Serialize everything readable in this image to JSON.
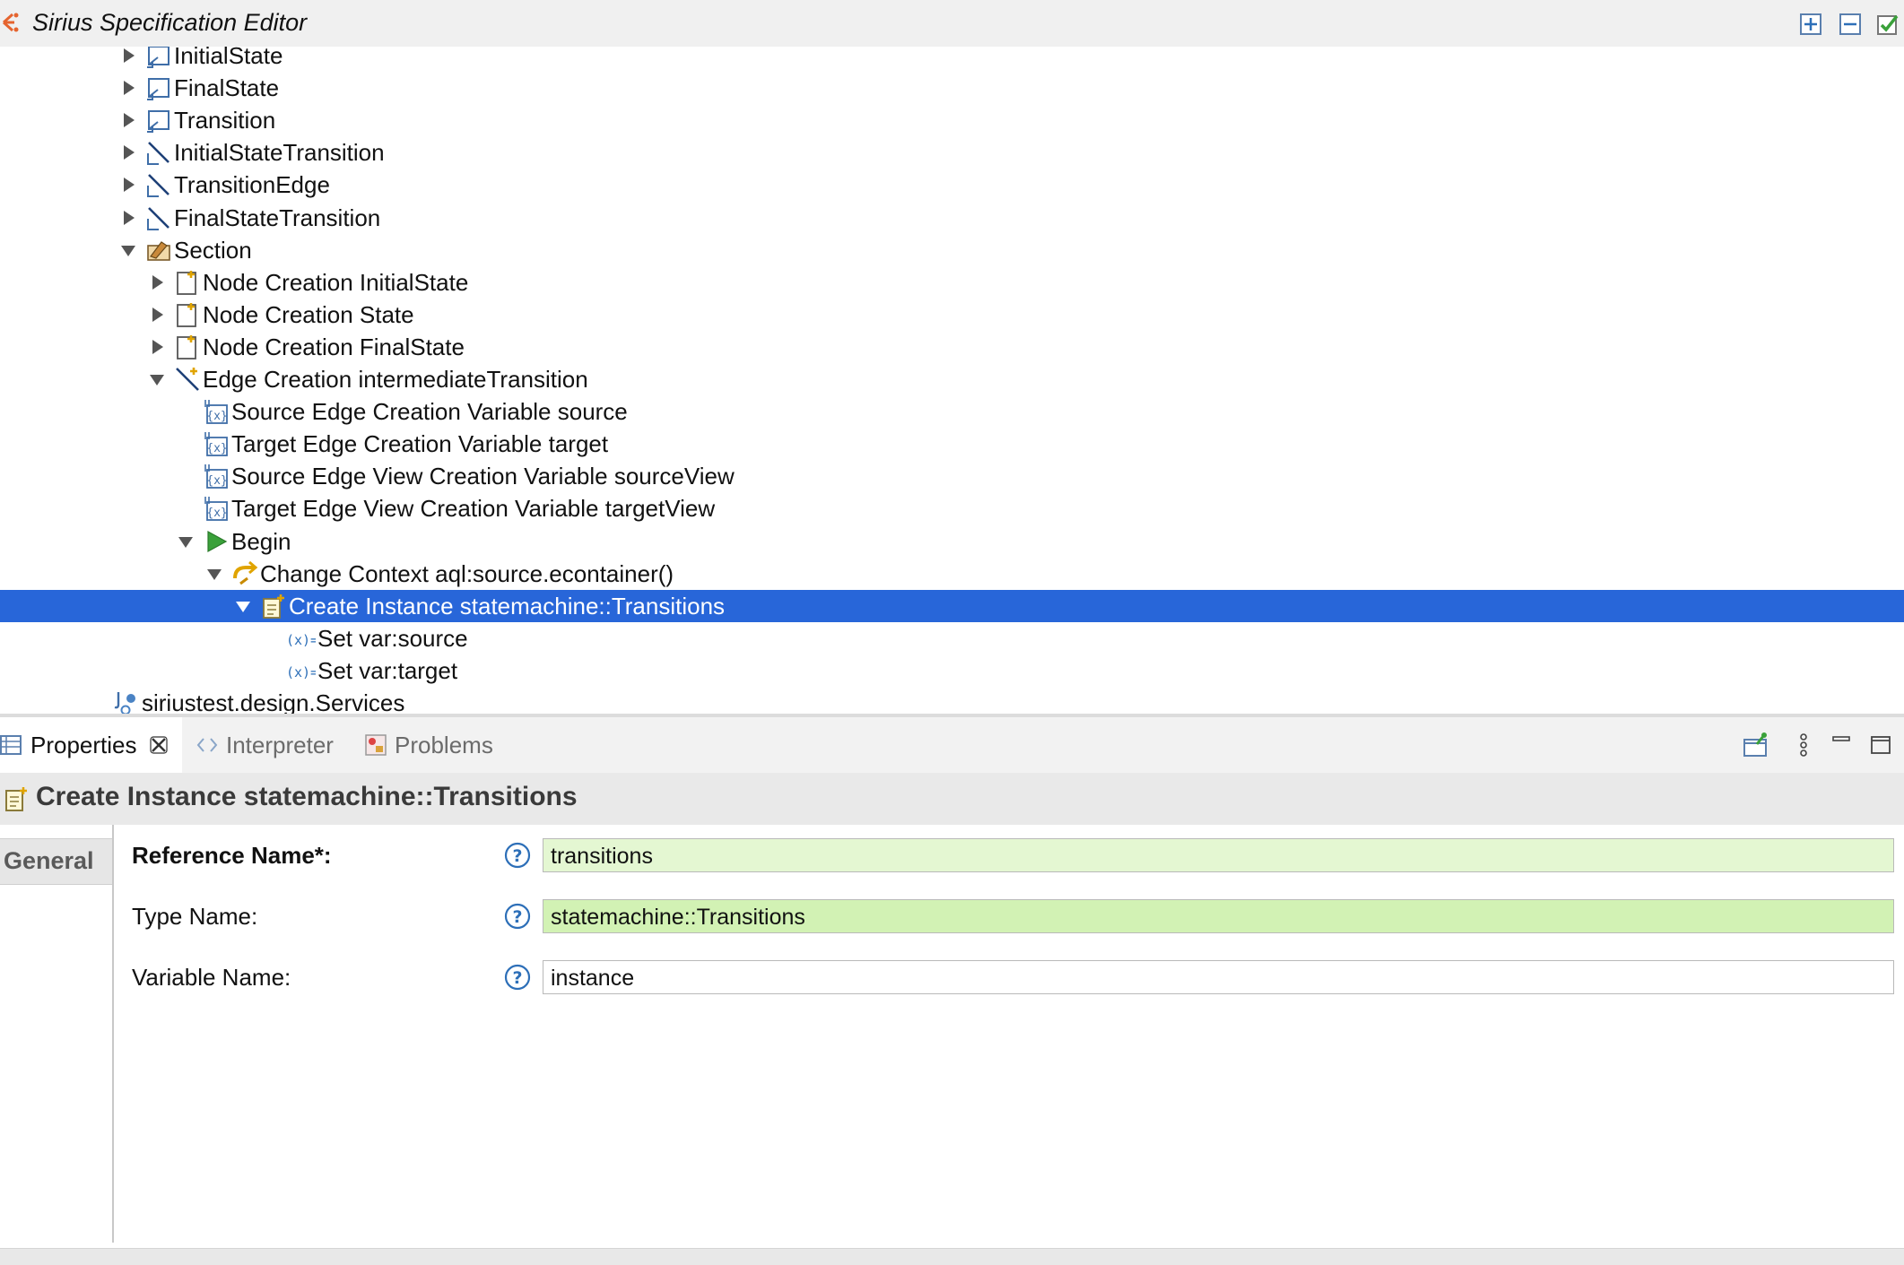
{
  "window": {
    "title": "Sirius Specification Editor",
    "icons": [
      "sirius-logo-icon",
      "expand-all-icon",
      "collapse-all-icon",
      "validate-icon"
    ]
  },
  "tree": {
    "rows": [
      {
        "label": "InitialState",
        "indent": 0,
        "twisty": "collapsed",
        "icon": "node-mapping-icon"
      },
      {
        "label": "FinalState",
        "indent": 0,
        "twisty": "collapsed",
        "icon": "node-mapping-icon"
      },
      {
        "label": "Transition",
        "indent": 0,
        "twisty": "collapsed",
        "icon": "node-mapping-icon"
      },
      {
        "label": "InitialStateTransition",
        "indent": 0,
        "twisty": "collapsed",
        "icon": "edge-mapping-icon"
      },
      {
        "label": "TransitionEdge",
        "indent": 0,
        "twisty": "collapsed",
        "icon": "edge-mapping-icon"
      },
      {
        "label": "FinalStateTransition",
        "indent": 0,
        "twisty": "collapsed",
        "icon": "edge-mapping-icon"
      },
      {
        "label": "Section",
        "indent": 0,
        "twisty": "expanded",
        "icon": "section-icon"
      },
      {
        "label": "Node Creation InitialState",
        "indent": 1,
        "twisty": "collapsed",
        "icon": "node-creation-icon"
      },
      {
        "label": "Node Creation State",
        "indent": 1,
        "twisty": "collapsed",
        "icon": "node-creation-icon"
      },
      {
        "label": "Node Creation FinalState",
        "indent": 1,
        "twisty": "collapsed",
        "icon": "node-creation-icon"
      },
      {
        "label": "Edge Creation intermediateTransition",
        "indent": 1,
        "twisty": "expanded",
        "icon": "edge-creation-icon"
      },
      {
        "label": "Source Edge Creation Variable source",
        "indent": 2,
        "twisty": "none",
        "icon": "variable-icon"
      },
      {
        "label": "Target Edge Creation Variable target",
        "indent": 2,
        "twisty": "none",
        "icon": "variable-icon"
      },
      {
        "label": "Source Edge View Creation Variable sourceView",
        "indent": 2,
        "twisty": "none",
        "icon": "variable-icon"
      },
      {
        "label": "Target Edge View Creation Variable targetView",
        "indent": 2,
        "twisty": "none",
        "icon": "variable-icon"
      },
      {
        "label": "Begin",
        "indent": 2,
        "twisty": "expanded",
        "icon": "begin-icon"
      },
      {
        "label": "Change Context aql:source.econtainer()",
        "indent": 3,
        "twisty": "expanded",
        "icon": "change-context-icon"
      },
      {
        "label": "Create Instance statemachine::Transitions",
        "indent": 4,
        "twisty": "expanded",
        "icon": "create-instance-icon",
        "selected": true
      },
      {
        "label": "Set var:source",
        "indent": 5,
        "twisty": "none",
        "icon": "set-value-icon"
      },
      {
        "label": "Set var:target",
        "indent": 5,
        "twisty": "none",
        "icon": "set-value-icon"
      },
      {
        "label": "siriustest.design.Services",
        "indent": -1,
        "twisty": "none",
        "icon": "java-extension-icon"
      }
    ]
  },
  "views": {
    "tabs": [
      {
        "label": "Properties",
        "icon": "properties-icon",
        "active": true
      },
      {
        "label": "Interpreter",
        "icon": "interpreter-icon"
      },
      {
        "label": "Problems",
        "icon": "problems-icon"
      }
    ],
    "close_icon": "close-icon",
    "toolbar_icons": [
      "pin-icon",
      "view-menu-icon",
      "minimize-icon",
      "maximize-icon"
    ]
  },
  "properties": {
    "header": "Create Instance statemachine::Transitions",
    "section_tab": "General",
    "fields": [
      {
        "label": "Reference Name*:",
        "value": "transitions",
        "bold": true
      },
      {
        "label": "Type Name:",
        "value": "statemachine::Transitions",
        "bold": false
      },
      {
        "label": "Variable Name:",
        "value": "instance",
        "bold": false
      }
    ]
  },
  "colors": {
    "selection": "#2866d9",
    "field_light_green": "#e4f7d2",
    "field_green": "#d2f2b4",
    "help_blue": "#2d6fb8"
  }
}
